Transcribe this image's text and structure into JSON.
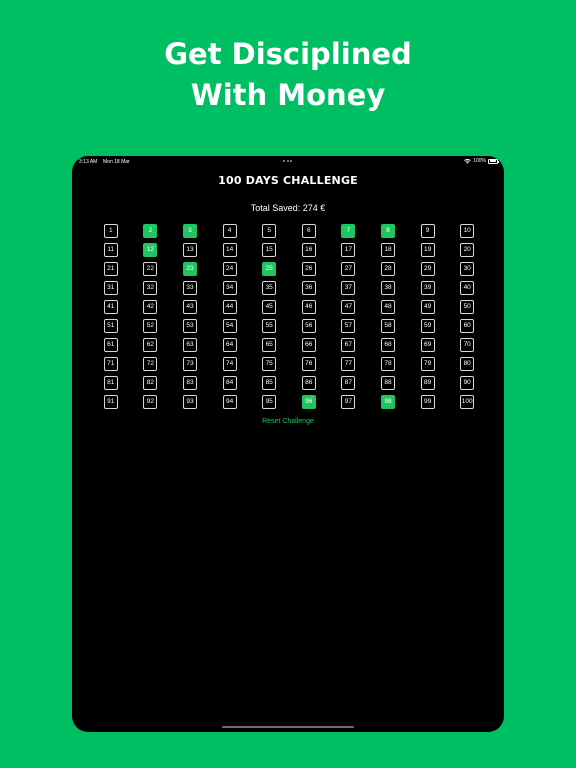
{
  "marketing": {
    "line1": "Get Disciplined",
    "line2": "With Money",
    "background_color": "#00bf63"
  },
  "status_bar": {
    "time": "3:13 AM",
    "date": "Mon 18 Mar",
    "battery": "100%",
    "icons": [
      "wifi-icon",
      "battery-icon"
    ]
  },
  "app": {
    "title": "100 DAYS CHALLENGE",
    "total_saved": "Total Saved: 274 €",
    "reset_label": "Reset Challenge",
    "accent_color": "#1fc65f"
  },
  "days": [
    {
      "n": "1",
      "saved": false
    },
    {
      "n": "2",
      "saved": true
    },
    {
      "n": "3",
      "saved": true
    },
    {
      "n": "4",
      "saved": false
    },
    {
      "n": "5",
      "saved": false
    },
    {
      "n": "6",
      "saved": false
    },
    {
      "n": "7",
      "saved": true
    },
    {
      "n": "8",
      "saved": true
    },
    {
      "n": "9",
      "saved": false
    },
    {
      "n": "10",
      "saved": false
    },
    {
      "n": "11",
      "saved": false
    },
    {
      "n": "12",
      "saved": true
    },
    {
      "n": "13",
      "saved": false
    },
    {
      "n": "14",
      "saved": false
    },
    {
      "n": "15",
      "saved": false
    },
    {
      "n": "16",
      "saved": false
    },
    {
      "n": "17",
      "saved": false
    },
    {
      "n": "18",
      "saved": false
    },
    {
      "n": "19",
      "saved": false
    },
    {
      "n": "20",
      "saved": false
    },
    {
      "n": "21",
      "saved": false
    },
    {
      "n": "22",
      "saved": false
    },
    {
      "n": "23",
      "saved": true
    },
    {
      "n": "24",
      "saved": false
    },
    {
      "n": "25",
      "saved": true
    },
    {
      "n": "26",
      "saved": false
    },
    {
      "n": "27",
      "saved": false
    },
    {
      "n": "28",
      "saved": false
    },
    {
      "n": "29",
      "saved": false
    },
    {
      "n": "30",
      "saved": false
    },
    {
      "n": "31",
      "saved": false
    },
    {
      "n": "32",
      "saved": false
    },
    {
      "n": "33",
      "saved": false
    },
    {
      "n": "34",
      "saved": false
    },
    {
      "n": "35",
      "saved": false
    },
    {
      "n": "36",
      "saved": false
    },
    {
      "n": "37",
      "saved": false
    },
    {
      "n": "38",
      "saved": false
    },
    {
      "n": "39",
      "saved": false
    },
    {
      "n": "40",
      "saved": false
    },
    {
      "n": "41",
      "saved": false
    },
    {
      "n": "42",
      "saved": false
    },
    {
      "n": "43",
      "saved": false
    },
    {
      "n": "44",
      "saved": false
    },
    {
      "n": "45",
      "saved": false
    },
    {
      "n": "46",
      "saved": false
    },
    {
      "n": "47",
      "saved": false
    },
    {
      "n": "48",
      "saved": false
    },
    {
      "n": "49",
      "saved": false
    },
    {
      "n": "50",
      "saved": false
    },
    {
      "n": "51",
      "saved": false
    },
    {
      "n": "52",
      "saved": false
    },
    {
      "n": "53",
      "saved": false
    },
    {
      "n": "54",
      "saved": false
    },
    {
      "n": "55",
      "saved": false
    },
    {
      "n": "56",
      "saved": false
    },
    {
      "n": "57",
      "saved": false
    },
    {
      "n": "58",
      "saved": false
    },
    {
      "n": "59",
      "saved": false
    },
    {
      "n": "60",
      "saved": false
    },
    {
      "n": "61",
      "saved": false
    },
    {
      "n": "62",
      "saved": false
    },
    {
      "n": "63",
      "saved": false
    },
    {
      "n": "64",
      "saved": false
    },
    {
      "n": "65",
      "saved": false
    },
    {
      "n": "66",
      "saved": false
    },
    {
      "n": "67",
      "saved": false
    },
    {
      "n": "68",
      "saved": false
    },
    {
      "n": "69",
      "saved": false
    },
    {
      "n": "70",
      "saved": false
    },
    {
      "n": "71",
      "saved": false
    },
    {
      "n": "72",
      "saved": false
    },
    {
      "n": "73",
      "saved": false
    },
    {
      "n": "74",
      "saved": false
    },
    {
      "n": "75",
      "saved": false
    },
    {
      "n": "76",
      "saved": false
    },
    {
      "n": "77",
      "saved": false
    },
    {
      "n": "78",
      "saved": false
    },
    {
      "n": "79",
      "saved": false
    },
    {
      "n": "80",
      "saved": false
    },
    {
      "n": "81",
      "saved": false
    },
    {
      "n": "82",
      "saved": false
    },
    {
      "n": "83",
      "saved": false
    },
    {
      "n": "84",
      "saved": false
    },
    {
      "n": "85",
      "saved": false
    },
    {
      "n": "86",
      "saved": false
    },
    {
      "n": "87",
      "saved": false
    },
    {
      "n": "88",
      "saved": false
    },
    {
      "n": "89",
      "saved": false
    },
    {
      "n": "90",
      "saved": false
    },
    {
      "n": "91",
      "saved": false
    },
    {
      "n": "92",
      "saved": false
    },
    {
      "n": "93",
      "saved": false
    },
    {
      "n": "94",
      "saved": false
    },
    {
      "n": "95",
      "saved": false
    },
    {
      "n": "96",
      "saved": true
    },
    {
      "n": "97",
      "saved": false
    },
    {
      "n": "98",
      "saved": true
    },
    {
      "n": "99",
      "saved": false
    },
    {
      "n": "100",
      "saved": false
    }
  ]
}
